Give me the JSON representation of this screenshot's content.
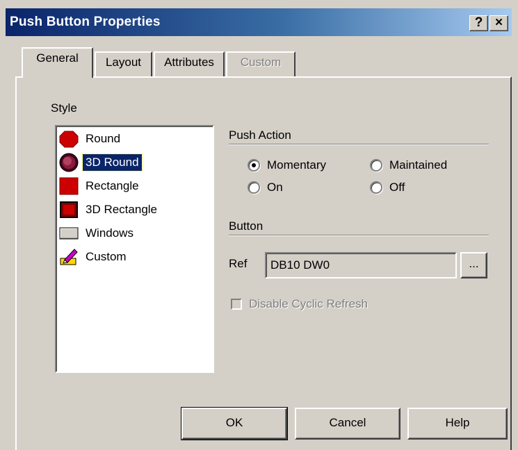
{
  "window": {
    "title": "Push Button Properties",
    "help_glyph": "?",
    "close_glyph": "×"
  },
  "tabs": [
    {
      "label": "General",
      "active": true
    },
    {
      "label": "Layout",
      "active": false
    },
    {
      "label": "Attributes",
      "active": false
    },
    {
      "label": "Custom",
      "active": false,
      "disabled": true
    }
  ],
  "style": {
    "label": "Style",
    "items": [
      {
        "label": "Round",
        "icon": "red-circle-icon",
        "selected": false
      },
      {
        "label": "3D Round",
        "icon": "3d-round-icon",
        "selected": true
      },
      {
        "label": "Rectangle",
        "icon": "red-square-icon",
        "selected": false
      },
      {
        "label": "3D Rectangle",
        "icon": "3d-rectangle-icon",
        "selected": false
      },
      {
        "label": "Windows",
        "icon": "windows-button-icon",
        "selected": false
      },
      {
        "label": "Custom",
        "icon": "custom-pencil-icon",
        "selected": false
      }
    ]
  },
  "push_action": {
    "label": "Push Action",
    "options": [
      {
        "label": "Momentary",
        "checked": true
      },
      {
        "label": "Maintained",
        "checked": false
      },
      {
        "label": "On",
        "checked": false
      },
      {
        "label": "Off",
        "checked": false
      }
    ]
  },
  "button_group": {
    "label": "Button",
    "ref_label": "Ref",
    "ref_value": "DB10 DW0",
    "browse_label": "..."
  },
  "disable_cyclic_refresh": {
    "label": "Disable Cyclic Refresh",
    "checked": false,
    "enabled": false
  },
  "footer": {
    "ok_label": "OK",
    "cancel_label": "Cancel",
    "help_label": "Help"
  },
  "colors": {
    "titlebar_start": "#0a246a",
    "titlebar_end": "#a6caf0",
    "face": "#d4d0c8",
    "selection": "#0a246a",
    "icon_red": "#cc0000"
  }
}
